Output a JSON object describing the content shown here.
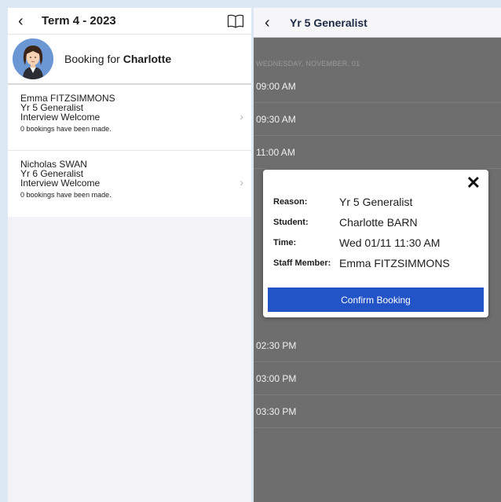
{
  "left": {
    "title": "Term 4 - 2023",
    "booking_prefix": "Booking for ",
    "booking_name": "Charlotte",
    "staff": [
      {
        "name": "Emma FITZSIMMONS",
        "role": "Yr 5 Generalist",
        "type": "Interview Welcome",
        "count": "0 bookings have been made."
      },
      {
        "name": "Nicholas SWAN",
        "role": "Yr 6 Generalist",
        "type": "Interview Welcome",
        "count": "0 bookings have been made."
      }
    ]
  },
  "right": {
    "title": "Yr 5 Generalist",
    "date": "WEDNESDAY, NOVEMBER, 01",
    "slots": [
      "09:00 AM",
      "09:30 AM",
      "11:00 AM",
      "02:30 PM",
      "03:00 PM",
      "03:30 PM"
    ]
  },
  "modal": {
    "reason_label": "Reason:",
    "reason": "Yr 5 Generalist",
    "student_label": "Student:",
    "student": "Charlotte BARN",
    "time_label": "Time:",
    "time": "Wed 01/11 11:30 AM",
    "staff_label": "Staff Member:",
    "staff": "Emma FITZSIMMONS",
    "confirm": "Confirm Booking"
  },
  "icons": {
    "back": "chevron-left-icon",
    "book": "book-open-icon",
    "close": "close-icon",
    "row": "chevron-right-icon"
  },
  "colors": {
    "accent": "#2254c8",
    "overlay": "#6e6e6e",
    "avatar_bg": "#6b98d4"
  }
}
